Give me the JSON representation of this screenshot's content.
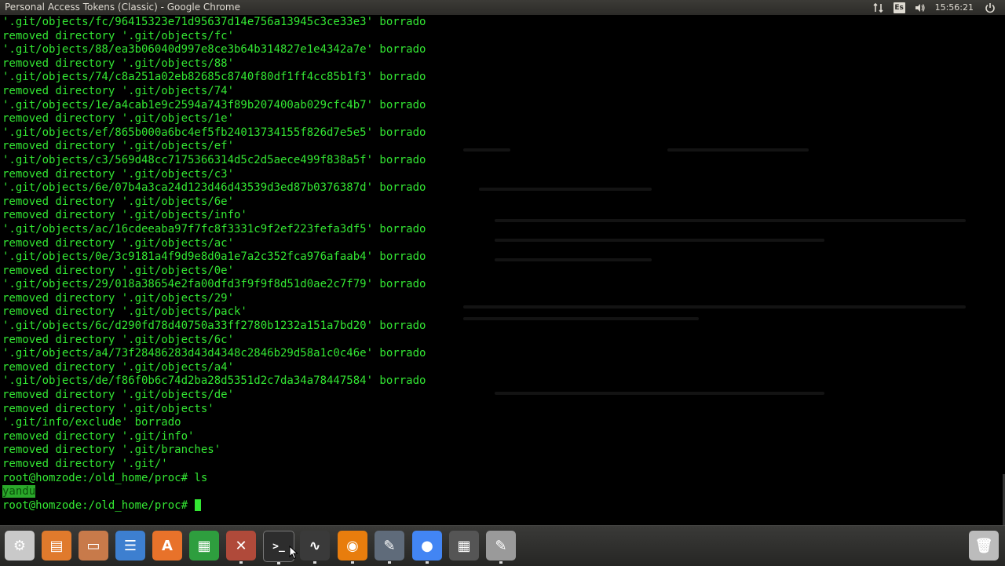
{
  "window": {
    "title": "Personal Access Tokens (Classic) - Google Chrome"
  },
  "tray": {
    "network_icon": "network-updown-icon",
    "language": "Es",
    "volume_icon": "speaker-icon",
    "time": "15:56:21",
    "power_icon": "power-icon"
  },
  "terminal": {
    "lines": [
      "'.git/objects/fc/96415323e71d95637d14e756a13945c3ce33e3' borrado",
      "removed directory '.git/objects/fc'",
      "'.git/objects/88/ea3b06040d997e8ce3b64b314827e1e4342a7e' borrado",
      "removed directory '.git/objects/88'",
      "'.git/objects/74/c8a251a02eb82685c8740f80df1ff4cc85b1f3' borrado",
      "removed directory '.git/objects/74'",
      "'.git/objects/1e/a4cab1e9c2594a743f89b207400ab029cfc4b7' borrado",
      "removed directory '.git/objects/1e'",
      "'.git/objects/ef/865b000a6bc4ef5fb24013734155f826d7e5e5' borrado",
      "removed directory '.git/objects/ef'",
      "'.git/objects/c3/569d48cc7175366314d5c2d5aece499f838a5f' borrado",
      "removed directory '.git/objects/c3'",
      "'.git/objects/6e/07b4a3ca24d123d46d43539d3ed87b0376387d' borrado",
      "removed directory '.git/objects/6e'",
      "removed directory '.git/objects/info'",
      "'.git/objects/ac/16cdeeaba97f7fc8f3331c9f2ef223fefa3df5' borrado",
      "removed directory '.git/objects/ac'",
      "'.git/objects/0e/3c9181a4f9d9e8d0a1e7a2c352fca976afaab4' borrado",
      "removed directory '.git/objects/0e'",
      "'.git/objects/29/018a38654e2fa00dfd3f9f9f8d51d0ae2c7f79' borrado",
      "removed directory '.git/objects/29'",
      "removed directory '.git/objects/pack'",
      "'.git/objects/6c/d290fd78d40750a33ff2780b1232a151a7bd20' borrado",
      "removed directory '.git/objects/6c'",
      "'.git/objects/a4/73f28486283d43d4348c2846b29d58a1c0c46e' borrado",
      "removed directory '.git/objects/a4'",
      "'.git/objects/de/f86f0b6c74d2ba28d5351d2c7da34a78447584' borrado",
      "removed directory '.git/objects/de'",
      "removed directory '.git/objects'",
      "'.git/info/exclude' borrado",
      "removed directory '.git/info'",
      "removed directory '.git/branches'",
      "removed directory '.git/'",
      "root@homzode:/old_home/proc# ls"
    ],
    "ls_output": "yandu",
    "prompt": "root@homzode:/old_home/proc# "
  },
  "dock": {
    "items": [
      {
        "name": "system-settings-icon",
        "color": "#c9c9c9"
      },
      {
        "name": "presentation-app-icon",
        "color": "#e07a2c"
      },
      {
        "name": "file-manager-icon",
        "color": "#c87a4a"
      },
      {
        "name": "text-document-icon",
        "color": "#3d7fd0"
      },
      {
        "name": "software-center-icon",
        "color": "#e8722a"
      },
      {
        "name": "spreadsheet-icon",
        "color": "#2e9e3e"
      },
      {
        "name": "system-tools-icon",
        "color": "#b04a3a"
      },
      {
        "name": "terminal-icon",
        "color": "#2d2d2d"
      },
      {
        "name": "system-monitor-icon",
        "color": "#3a3a3a"
      },
      {
        "name": "blender-icon",
        "color": "#e87d0d"
      },
      {
        "name": "screenshot-tool-icon",
        "color": "#5f6b7a"
      },
      {
        "name": "chrome-icon",
        "color": "#4285f4"
      },
      {
        "name": "calculator-icon",
        "color": "#555555"
      },
      {
        "name": "text-editor-icon",
        "color": "#9a9a9a"
      },
      {
        "name": "trash-icon",
        "color": "#bcbcbc"
      }
    ]
  }
}
